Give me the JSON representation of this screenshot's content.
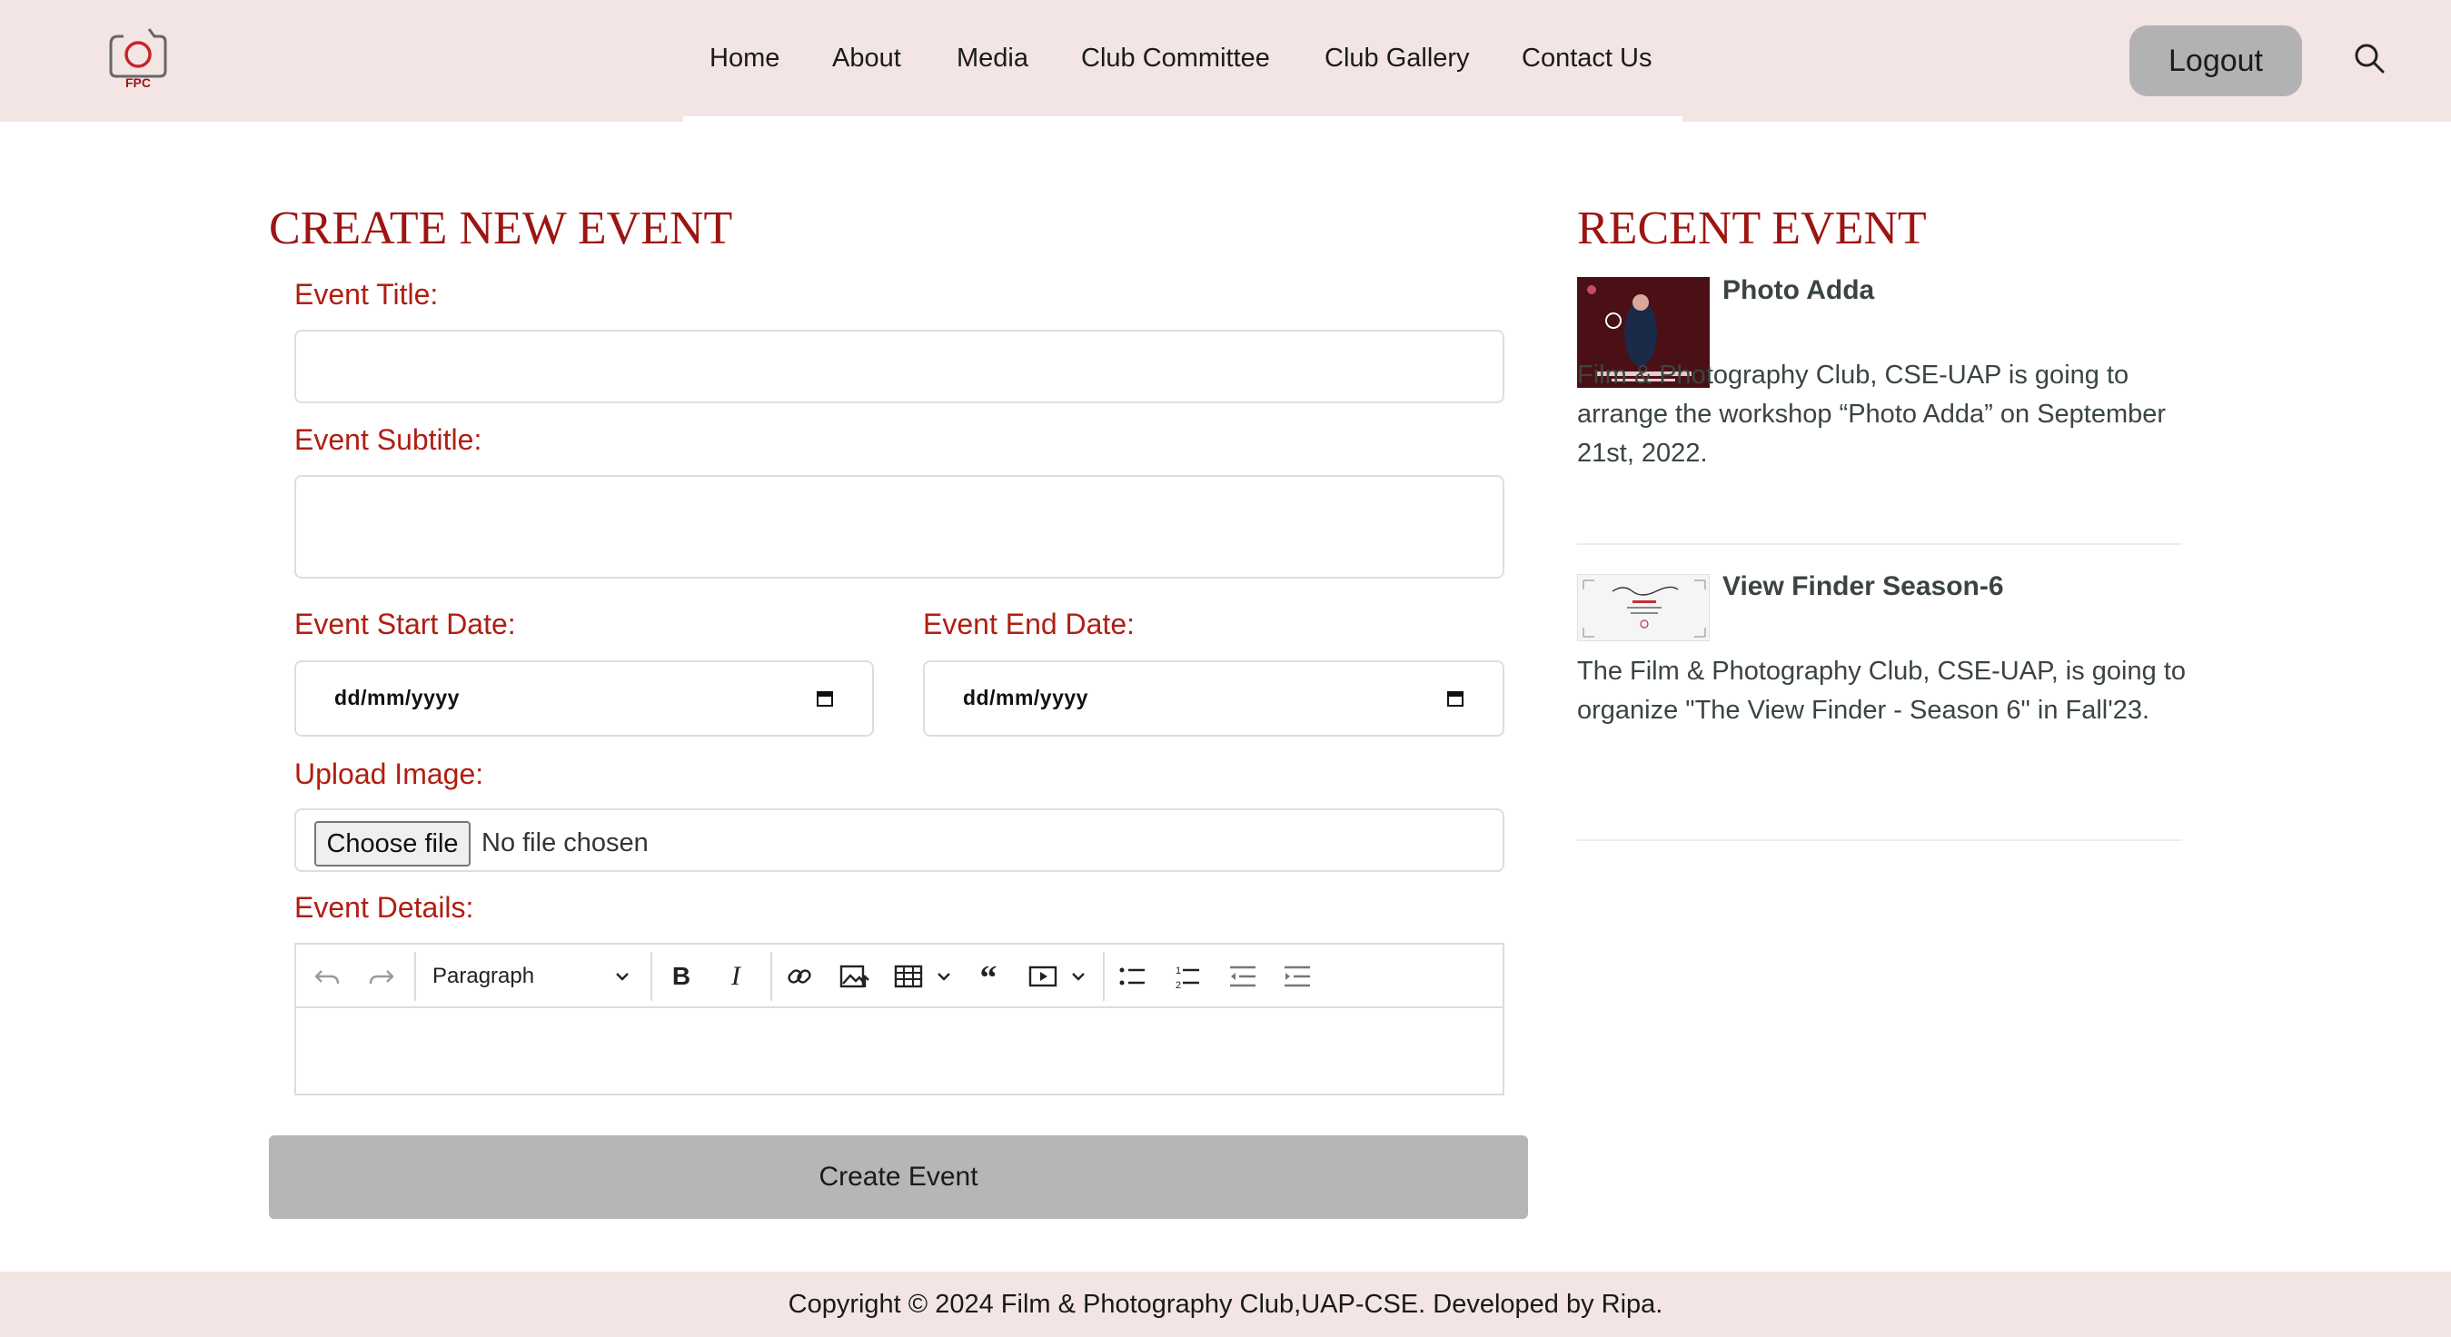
{
  "header": {
    "logo_text": "FPC",
    "nav": [
      "Home",
      "About",
      "Media",
      "Club Committee",
      "Club Gallery",
      "Contact Us"
    ],
    "logout_label": "Logout"
  },
  "form": {
    "heading": "CREATE NEW EVENT",
    "title_label": "Event Title:",
    "title_value": "",
    "subtitle_label": "Event Subtitle:",
    "subtitle_value": "",
    "start_date_label": "Event Start Date:",
    "start_date_placeholder": "dd/mm/yyyy",
    "end_date_label": "Event End Date:",
    "end_date_placeholder": "dd/mm/yyyy",
    "upload_label": "Upload Image:",
    "choose_file_label": "Choose file",
    "file_status": "No file chosen",
    "details_label": "Event Details:",
    "editor_block_format": "Paragraph",
    "submit_label": "Create Event"
  },
  "recent": {
    "heading": "RECENT EVENT",
    "events": [
      {
        "title": "Photo Adda",
        "description": "Film & Photography Club, CSE-UAP is going to arrange the workshop “Photo Adda” on September 21st, 2022."
      },
      {
        "title": "View Finder Season-6",
        "description": "The Film & Photography Club, CSE-UAP, is going to organize \"The View Finder - Season 6\" in Fall'23."
      }
    ]
  },
  "footer": {
    "copyright": "Copyright © 2024 Film & Photography Club,UAP-CSE. Developed by Ripa."
  },
  "colors": {
    "brand_red": "#9c1512",
    "label_red": "#b01e12",
    "header_bg": "#f2e5e4",
    "button_gray": "#b6b5b7"
  }
}
